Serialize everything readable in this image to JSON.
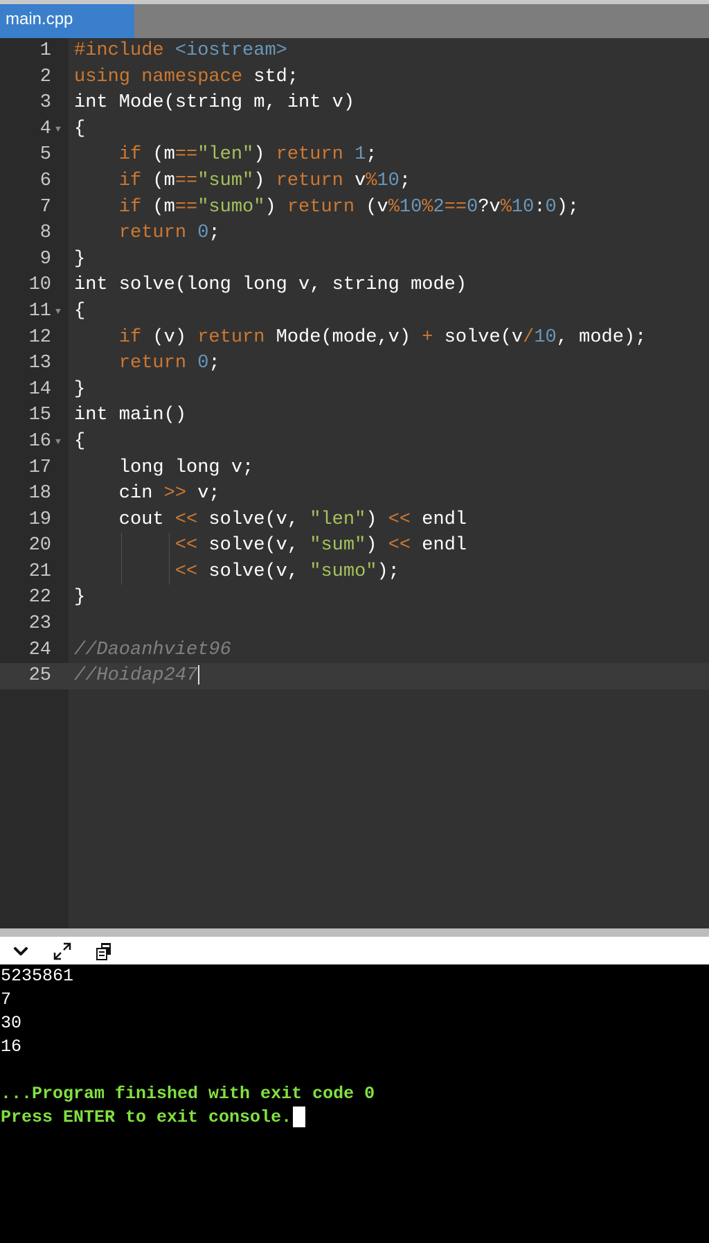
{
  "tab": {
    "label": "main.cpp"
  },
  "code": {
    "l1": "1",
    "l2": "2",
    "l3": "3",
    "l4": "4",
    "l5": "5",
    "l6": "6",
    "l7": "7",
    "l8": "8",
    "l9": "9",
    "l10": "10",
    "l11": "11",
    "l12": "12",
    "l13": "13",
    "l14": "14",
    "l15": "15",
    "l16": "16",
    "l17": "17",
    "l18": "18",
    "l19": "19",
    "l20": "20",
    "l21": "21",
    "l22": "22",
    "l23": "23",
    "l24": "24",
    "l25": "25"
  },
  "toolbar": {
    "icons": [
      "chevron-down-icon",
      "expand-icon",
      "copy-icon"
    ]
  },
  "console": {
    "input": "5235861",
    "output1": "7",
    "output2": "30",
    "output3": "16",
    "finished": "...Program finished with exit code 0",
    "press": "Press ENTER to exit console."
  },
  "colors": {
    "keyword": "#cc7832",
    "number": "#6897bb",
    "string": "#a5c25c",
    "comment": "#808080",
    "tab": "#3a7fcb",
    "console_msg": "#80e040"
  }
}
